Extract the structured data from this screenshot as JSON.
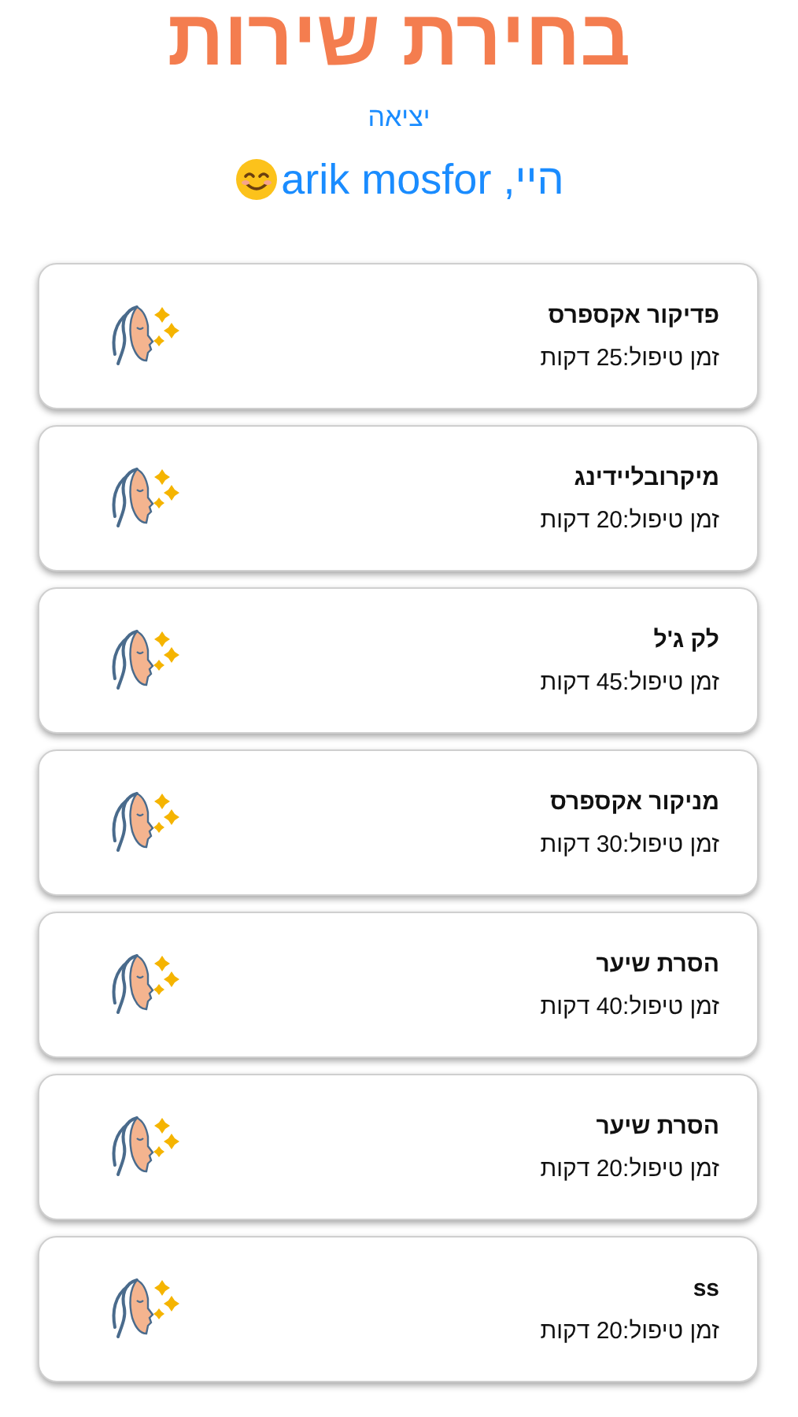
{
  "title": "בחירת שירות",
  "logout_link": "יציאה",
  "greeting": "היי, arik mosfor",
  "services": [
    {
      "name": "פדיקור אקספרס",
      "duration": "זמן טיפול:25 דקות"
    },
    {
      "name": "מיקרובליידינג",
      "duration": "זמן טיפול:20 דקות"
    },
    {
      "name": "לק ג'ל",
      "duration": "זמן טיפול:45 דקות"
    },
    {
      "name": "מניקור אקספרס",
      "duration": "זמן טיפול:30 דקות"
    },
    {
      "name": "הסרת שיער",
      "duration": "זמן טיפול:40 דקות"
    },
    {
      "name": "הסרת שיער",
      "duration": "זמן טיפול:20 דקות"
    },
    {
      "name": "ss",
      "duration": "זמן טיפול:20 דקות"
    }
  ]
}
